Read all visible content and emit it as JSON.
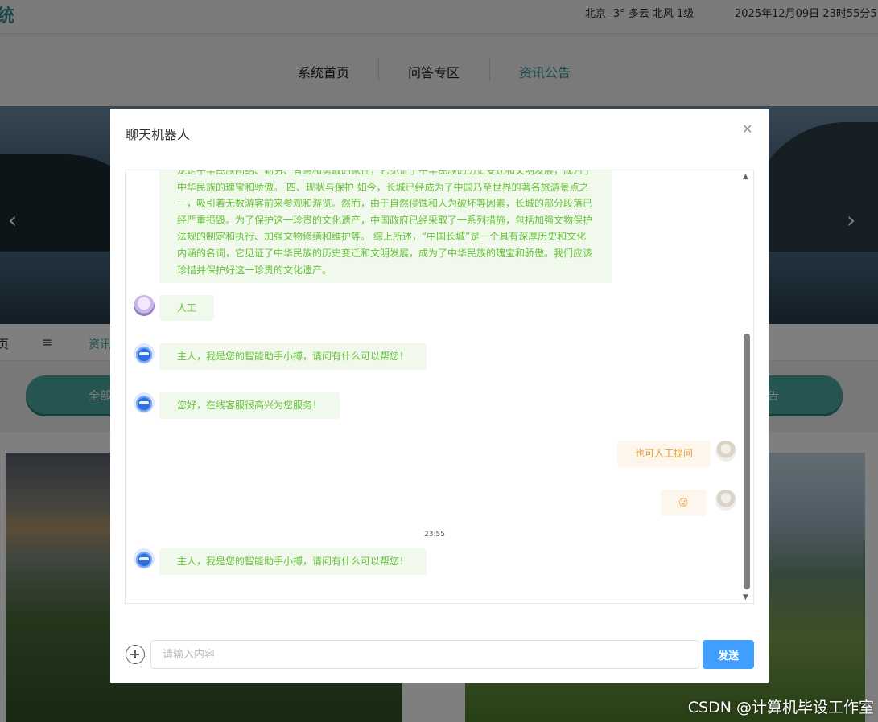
{
  "site": {
    "title": "统"
  },
  "header": {
    "weather": "北京  -3°  多云  北风  1级",
    "datetime": "2025年12月09日 23时55分5"
  },
  "nav": {
    "items": [
      {
        "label": "系统首页",
        "active": false
      },
      {
        "label": "问答专区",
        "active": false
      },
      {
        "label": "资讯公告",
        "active": true
      }
    ]
  },
  "banner": {
    "prev_icon": "chevron-left-icon",
    "next_icon": "chevron-right-icon"
  },
  "subnav": {
    "cut_label": "页",
    "menu_icon": "menu-icon",
    "link_label": "资讯"
  },
  "filters": {
    "left_label": "全部",
    "right_label": "告"
  },
  "watermark": "CSDN @计算机毕设工作室",
  "dialog": {
    "title": "聊天机器人",
    "close_icon": "close-icon",
    "messages": [
      {
        "role": "bot",
        "text": "龙是中华民族团结、勤劳、智慧和勇敢的象征，它见证了中华民族的历史变迁和文明发展，成为了中华民族的瑰宝和骄傲。 四、现状与保护 如今，长城已经成为了中国乃至世界的著名旅游景点之一，吸引着无数游客前来参观和游览。然而，由于自然侵蚀和人为破坏等因素，长城的部分段落已经严重损毁。为了保护这一珍贵的文化遗产，中国政府已经采取了一系列措施，包括加强文物保护法规的制定和执行、加强文物修缮和维护等。 综上所述，“中国长城”是一个具有深厚历史和文化内涵的名词，它见证了中华民族的历史变迁和文明发展，成为了中华民族的瑰宝和骄傲。我们应该珍惜并保护好这一珍贵的文化遗产。"
      },
      {
        "role": "user-left",
        "text": "人工"
      },
      {
        "role": "bot",
        "text": "主人，我是您的智能助手小搏，请问有什么可以帮您！"
      },
      {
        "role": "bot",
        "text": "您好，在线客服很高兴为您服务！"
      },
      {
        "role": "user",
        "text": "也可人工提问"
      },
      {
        "role": "user",
        "text": "😜"
      },
      {
        "role": "time",
        "text": "23:55"
      },
      {
        "role": "bot",
        "text": "主人，我是您的智能助手小搏，请问有什么可以帮您！"
      }
    ],
    "input": {
      "placeholder": "请输入内容",
      "value": ""
    },
    "send_label": "发送"
  },
  "colors": {
    "accent": "#3aa39f",
    "bot_bubble_bg": "#f0f9eb",
    "bot_text": "#67c23a",
    "user_bubble_bg": "#fdf6ec",
    "user_text": "#e6a23c",
    "send_button": "#409eff"
  }
}
